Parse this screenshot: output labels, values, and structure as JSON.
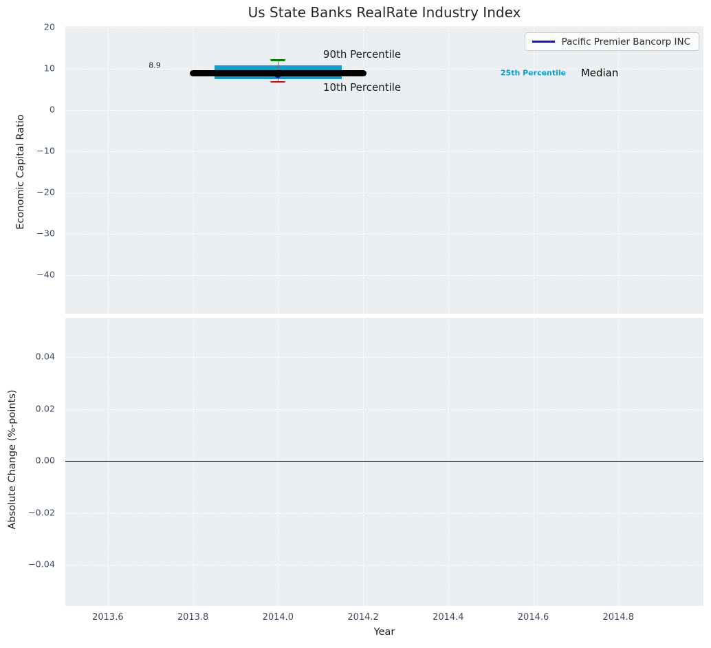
{
  "chart_data": {
    "type": "line",
    "title": "Us State Banks RealRate Industry Index",
    "xlabel": "Year",
    "xlim": [
      2013.5,
      2015.0
    ],
    "xticks": [
      {
        "v": 2013.6,
        "label": "2013.6"
      },
      {
        "v": 2013.8,
        "label": "2013.8"
      },
      {
        "v": 2014.0,
        "label": "2014.0"
      },
      {
        "v": 2014.2,
        "label": "2014.2"
      },
      {
        "v": 2014.4,
        "label": "2014.4"
      },
      {
        "v": 2014.6,
        "label": "2014.6"
      },
      {
        "v": 2014.8,
        "label": "2014.8"
      }
    ],
    "grid": true,
    "legend": {
      "label": "Pacific Premier Bancorp INC",
      "position": "upper right",
      "line_color": "#0f0fdc"
    },
    "subplots": [
      {
        "ylabel": "Economic Capital Ratio",
        "ylim": [
          -49.3,
          20.35
        ],
        "yticks": [
          {
            "v": 20,
            "label": "20"
          },
          {
            "v": 10,
            "label": "10"
          },
          {
            "v": 0,
            "label": "0"
          },
          {
            "v": -10,
            "label": "−10"
          },
          {
            "v": -20,
            "label": "−20"
          },
          {
            "v": -30,
            "label": "−30"
          },
          {
            "v": -40,
            "label": "−40"
          }
        ]
      },
      {
        "ylabel": "Absolute Change (%-points)",
        "ylim": [
          -0.0558,
          0.0552
        ],
        "yticks": [
          {
            "v": 0.04,
            "label": "0.04"
          },
          {
            "v": 0.02,
            "label": "0.02"
          },
          {
            "v": 0.0,
            "label": "0.00"
          },
          {
            "v": -0.02,
            "label": "−0.02"
          },
          {
            "v": -0.04,
            "label": "−0.04"
          }
        ],
        "zero_line": 0.0
      }
    ],
    "industry_stats": {
      "year": 2014.0,
      "median": 8.9,
      "p25": 7.55,
      "p75": 10.8,
      "p10": 6.85,
      "p90": 12.1,
      "company_value": 8.45
    },
    "series": [
      {
        "name": "25th-75th Percentile band",
        "type": "band",
        "x_start": 2013.85,
        "x_end": 2014.15,
        "y_low": 7.55,
        "y_high": 10.8,
        "color": "#0d9dd1"
      },
      {
        "name": "90th-10th Percentile errorbar",
        "type": "errorbar",
        "x": 2014.0,
        "y_top": 12.1,
        "y_bottom": 6.85,
        "cap_top_color": "#008000",
        "cap_bottom_color": "#e60000",
        "line_color": "#6b6b6b"
      },
      {
        "name": "Pacific Premier Bancorp INC",
        "type": "marker",
        "x": 2014.0,
        "y": 8.45,
        "color": "#0000e0",
        "size": 9
      },
      {
        "name": "Median",
        "type": "hline",
        "x_start": 2013.8,
        "x_end": 2014.2,
        "y": 8.9,
        "color": "#000000",
        "thickness": 9
      }
    ],
    "annotations": [
      {
        "id": "value-label",
        "text": "8.9",
        "x": 2013.696,
        "y": 10.9,
        "size": 11,
        "color": "#262626",
        "weight": "normal"
      },
      {
        "id": "p90-label",
        "text": "90th Percentile",
        "x": 2014.106,
        "y": 13.6,
        "size": 15,
        "color": "#1a1a1a",
        "weight": "normal"
      },
      {
        "id": "p10-label",
        "text": "10th Percentile",
        "x": 2014.106,
        "y": 5.5,
        "size": 15,
        "color": "#1a1a1a",
        "weight": "normal"
      },
      {
        "id": "p25-label",
        "text": "25th Percentile",
        "x": 2014.523,
        "y": 9.0,
        "size": 11,
        "color": "#0d9dd1",
        "weight": "bold"
      },
      {
        "id": "median-label",
        "text": "Median",
        "x": 2014.712,
        "y": 9.0,
        "size": 15,
        "color": "#000000",
        "weight": "normal"
      }
    ],
    "colors": {
      "axes_background": "#ebeff1",
      "gridline": "#ffffff",
      "tick_label": "#3d4c63",
      "text": "#262626",
      "median": "#000000",
      "percentile_band": "#0d9dd1",
      "p90_cap": "#008000",
      "p10_cap": "#e60000",
      "company": "#0000e0"
    }
  }
}
